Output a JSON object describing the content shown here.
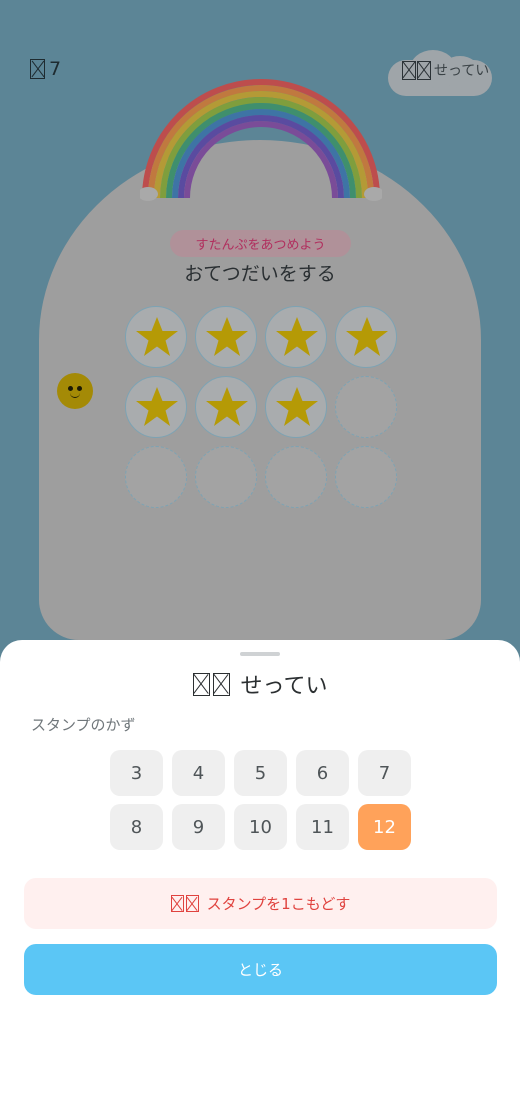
{
  "header": {
    "stamp_count": "7",
    "settings_label": "せってい"
  },
  "card": {
    "subtitle": "すたんぷをあつめよう",
    "task_title": "おてつだいをする",
    "stamps_total": 12,
    "stamps_filled": 7,
    "star_color": "#b59a06"
  },
  "sheet": {
    "title": "せってい",
    "section_label": "スタンプのかず",
    "count_options": [
      "3",
      "4",
      "5",
      "6",
      "7",
      "8",
      "9",
      "10",
      "11",
      "12"
    ],
    "selected_count": "12",
    "undo_label": "スタンプを1こもどす",
    "close_label": "とじる"
  },
  "colors": {
    "accent_orange": "#ffa25a",
    "close_blue": "#5bc6f5",
    "undo_red": "#e0433f"
  }
}
